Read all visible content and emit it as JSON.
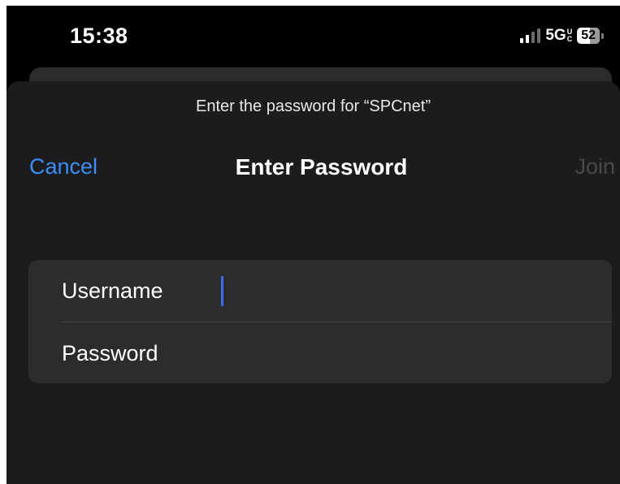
{
  "status_bar": {
    "time": "15:38",
    "network": "5G",
    "network_sup_top": "U",
    "network_sup_bottom": "C",
    "battery": "52"
  },
  "sheet": {
    "prompt": "Enter the password for “SPCnet”",
    "nav": {
      "cancel_label": "Cancel",
      "title": "Enter Password",
      "join_label": "Join"
    },
    "form": {
      "username_label": "Username",
      "username_value": "",
      "password_label": "Password",
      "password_value": ""
    }
  },
  "colors": {
    "accent": "#3a8ef6",
    "sheet_background": "#1c1c1e",
    "field_background": "#2c2c2e",
    "disabled_text": "#4a4a4c"
  }
}
